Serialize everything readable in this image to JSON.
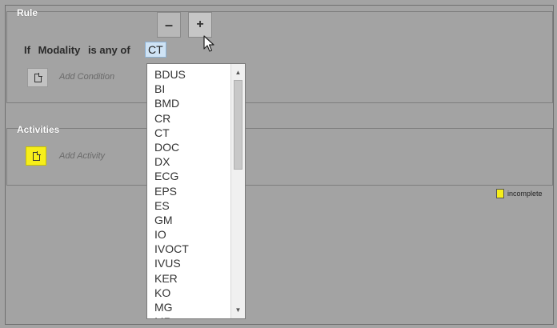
{
  "rule_panel": {
    "title": "Rule"
  },
  "stepper": {
    "minus_label": "–",
    "plus_label": "+"
  },
  "rule": {
    "if_label": "If",
    "field": "Modality",
    "operator": "is any of",
    "value": "CT"
  },
  "add_condition": {
    "label": "Add Condition",
    "icon": "document-icon"
  },
  "activities_panel": {
    "title": "Activities"
  },
  "add_activity": {
    "label": "Add Activity",
    "icon": "document-icon"
  },
  "legend": {
    "label": "incomplete",
    "color": "#f6ee1a"
  },
  "modality_dropdown": {
    "options": [
      "BDUS",
      "BI",
      "BMD",
      "CR",
      "CT",
      "DOC",
      "DX",
      "ECG",
      "EPS",
      "ES",
      "GM",
      "IO",
      "IVOCT",
      "IVUS",
      "KER",
      "KO",
      "MG",
      "MR"
    ]
  }
}
